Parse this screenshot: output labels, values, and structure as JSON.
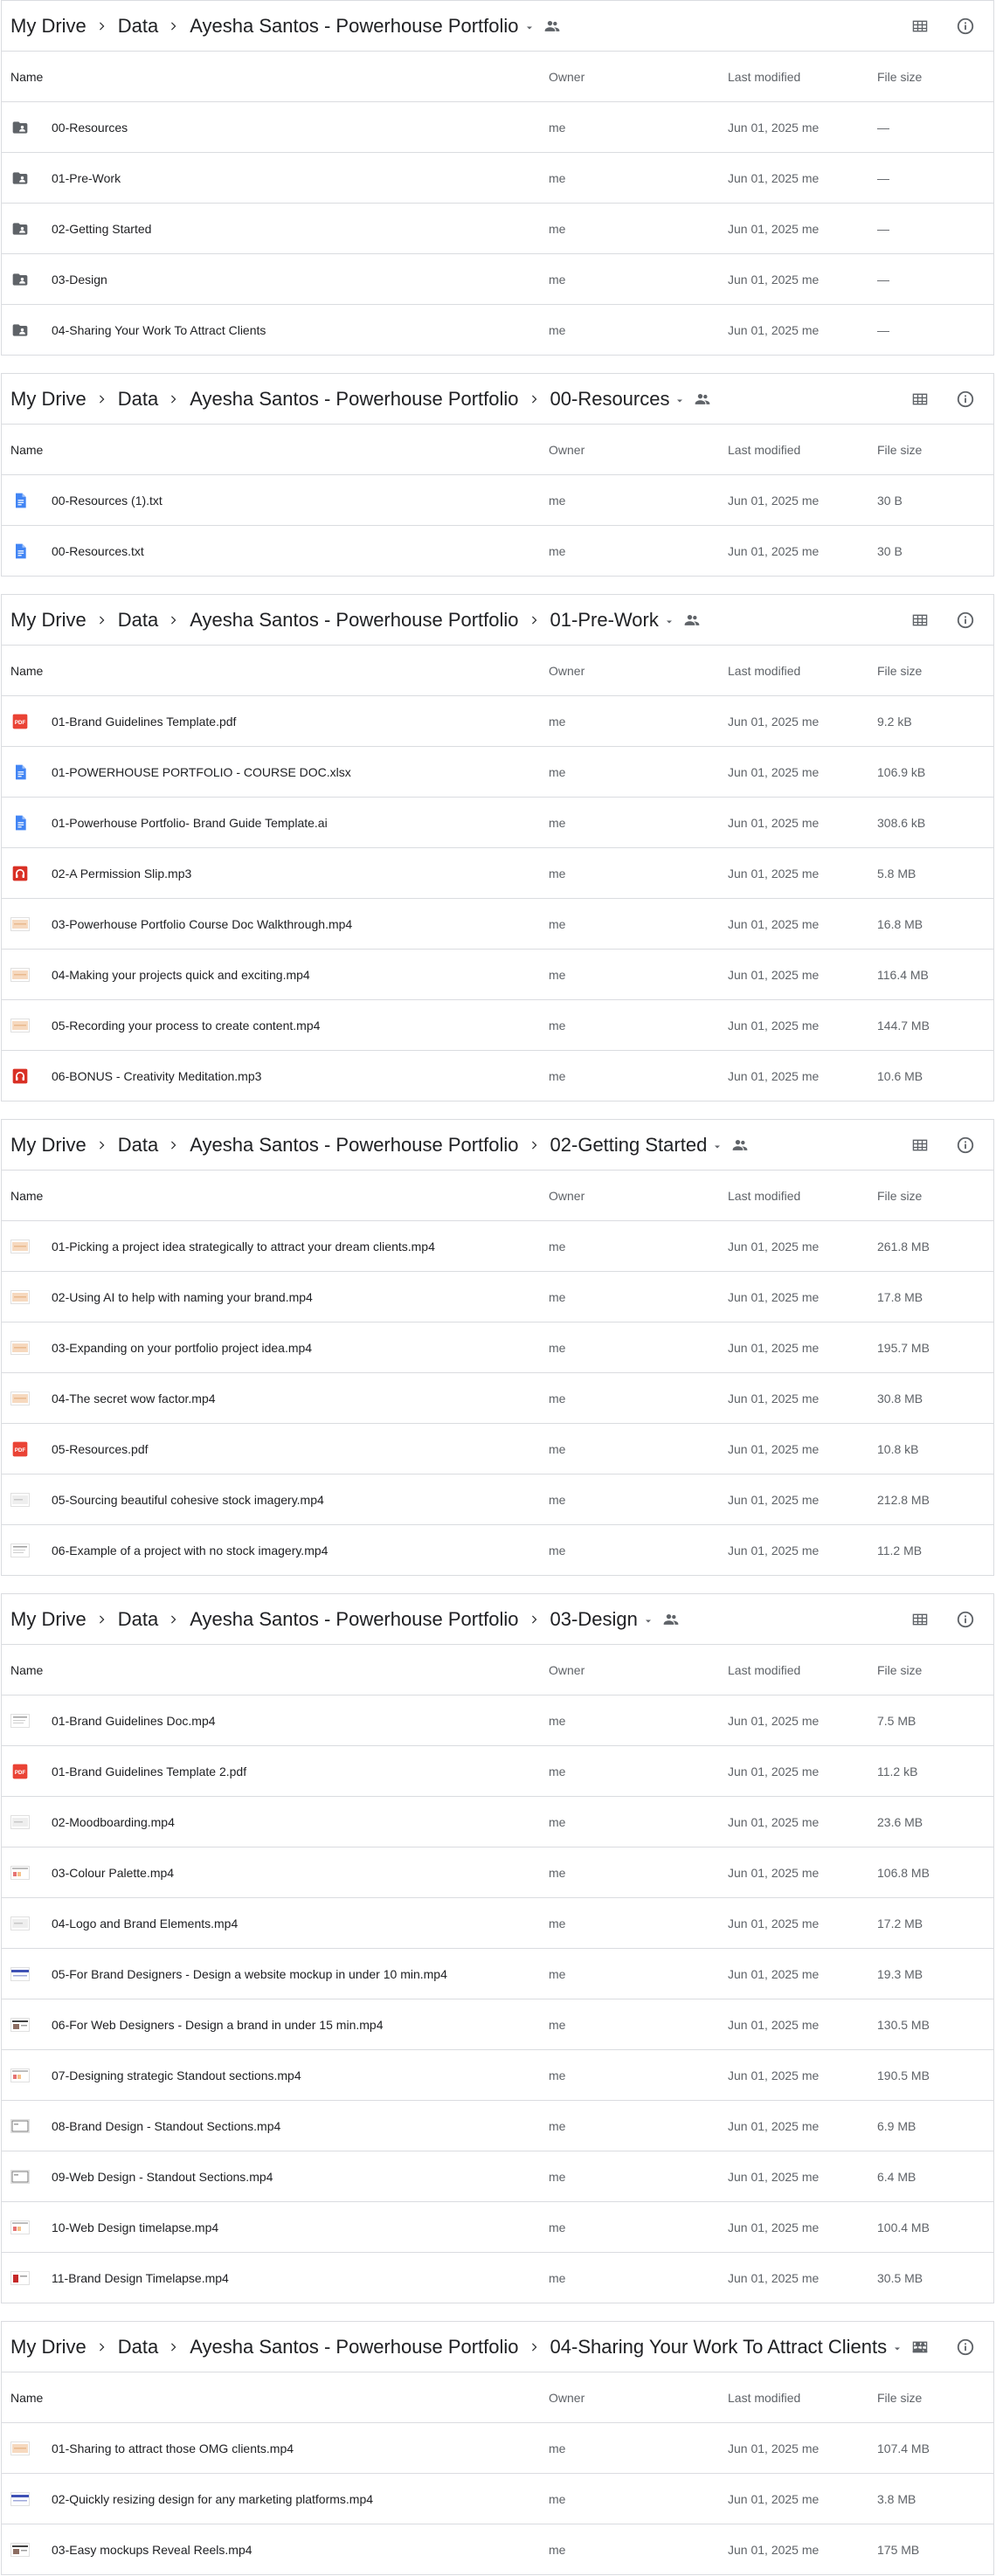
{
  "columns": {
    "name": "Name",
    "owner": "Owner",
    "modified": "Last modified",
    "size": "File size"
  },
  "colors": {
    "folder": "#5f6368",
    "doc": "#4285f4",
    "pdf": "#ea4335",
    "audio": "#d93025",
    "border": "#dadce0"
  },
  "panels": [
    {
      "crumbs": [
        "My Drive",
        "Data",
        "Ayesha Santos - Powerhouse Portfolio"
      ],
      "rows": [
        {
          "icon": "folder-shared",
          "name": "00-Resources",
          "owner": "me",
          "modified": "Jun 01, 2025 me",
          "size": "—"
        },
        {
          "icon": "folder-shared",
          "name": "01-Pre-Work",
          "owner": "me",
          "modified": "Jun 01, 2025 me",
          "size": "—"
        },
        {
          "icon": "folder-shared",
          "name": "02-Getting Started",
          "owner": "me",
          "modified": "Jun 01, 2025 me",
          "size": "—"
        },
        {
          "icon": "folder-shared",
          "name": "03-Design",
          "owner": "me",
          "modified": "Jun 01, 2025 me",
          "size": "—"
        },
        {
          "icon": "folder-shared",
          "name": "04-Sharing Your Work To Attract Clients",
          "owner": "me",
          "modified": "Jun 01, 2025 me",
          "size": "—"
        }
      ]
    },
    {
      "crumbs": [
        "My Drive",
        "Data",
        "Ayesha Santos - Powerhouse Portfolio",
        "00-Resources"
      ],
      "rows": [
        {
          "icon": "doc",
          "name": "00-Resources (1).txt",
          "owner": "me",
          "modified": "Jun 01, 2025 me",
          "size": "30 B"
        },
        {
          "icon": "doc",
          "name": "00-Resources.txt",
          "owner": "me",
          "modified": "Jun 01, 2025 me",
          "size": "30 B"
        }
      ]
    },
    {
      "crumbs": [
        "My Drive",
        "Data",
        "Ayesha Santos - Powerhouse Portfolio",
        "01-Pre-Work"
      ],
      "rows": [
        {
          "icon": "pdf",
          "name": "01-Brand Guidelines Template.pdf",
          "owner": "me",
          "modified": "Jun 01, 2025 me",
          "size": "9.2 kB"
        },
        {
          "icon": "doc",
          "name": "01-POWERHOUSE PORTFOLIO - COURSE DOC.xlsx",
          "owner": "me",
          "modified": "Jun 01, 2025 me",
          "size": "106.9 kB"
        },
        {
          "icon": "doc",
          "name": "01-Powerhouse Portfolio- Brand Guide Template.ai",
          "owner": "me",
          "modified": "Jun 01, 2025 me",
          "size": "308.6 kB"
        },
        {
          "icon": "audio",
          "name": "02-A Permission Slip.mp3",
          "owner": "me",
          "modified": "Jun 01, 2025 me",
          "size": "5.8 MB"
        },
        {
          "icon": "video-beige",
          "name": "03-Powerhouse Portfolio Course Doc Walkthrough.mp4",
          "owner": "me",
          "modified": "Jun 01, 2025 me",
          "size": "16.8 MB"
        },
        {
          "icon": "video-beige",
          "name": "04-Making your projects quick and exciting.mp4",
          "owner": "me",
          "modified": "Jun 01, 2025 me",
          "size": "116.4 MB"
        },
        {
          "icon": "video-beige",
          "name": "05-Recording your process to create content.mp4",
          "owner": "me",
          "modified": "Jun 01, 2025 me",
          "size": "144.7 MB"
        },
        {
          "icon": "audio",
          "name": "06-BONUS - Creativity Meditation.mp3",
          "owner": "me",
          "modified": "Jun 01, 2025 me",
          "size": "10.6 MB"
        }
      ]
    },
    {
      "crumbs": [
        "My Drive",
        "Data",
        "Ayesha Santos - Powerhouse Portfolio",
        "02-Getting Started"
      ],
      "rows": [
        {
          "icon": "video-beige",
          "name": "01-Picking a project idea strategically to attract your dream clients.mp4",
          "owner": "me",
          "modified": "Jun 01, 2025 me",
          "size": "261.8 MB"
        },
        {
          "icon": "video-beige",
          "name": "02-Using AI to help with naming your brand.mp4",
          "owner": "me",
          "modified": "Jun 01, 2025 me",
          "size": "17.8 MB"
        },
        {
          "icon": "video-beige",
          "name": "03-Expanding on your portfolio project idea.mp4",
          "owner": "me",
          "modified": "Jun 01, 2025 me",
          "size": "195.7 MB"
        },
        {
          "icon": "video-beige",
          "name": "04-The secret wow factor.mp4",
          "owner": "me",
          "modified": "Jun 01, 2025 me",
          "size": "30.8 MB"
        },
        {
          "icon": "pdf",
          "name": "05-Resources.pdf",
          "owner": "me",
          "modified": "Jun 01, 2025 me",
          "size": "10.8 kB"
        },
        {
          "icon": "video-grey",
          "name": "05-Sourcing beautiful cohesive stock imagery.mp4",
          "owner": "me",
          "modified": "Jun 01, 2025 me",
          "size": "212.8 MB"
        },
        {
          "icon": "video-lines",
          "name": "06-Example of a project with no stock imagery.mp4",
          "owner": "me",
          "modified": "Jun 01, 2025 me",
          "size": "11.2 MB"
        }
      ]
    },
    {
      "crumbs": [
        "My Drive",
        "Data",
        "Ayesha Santos - Powerhouse Portfolio",
        "03-Design"
      ],
      "rows": [
        {
          "icon": "video-lines",
          "name": "01-Brand Guidelines Doc.mp4",
          "owner": "me",
          "modified": "Jun 01, 2025 me",
          "size": "7.5 MB"
        },
        {
          "icon": "pdf",
          "name": "01-Brand Guidelines Template 2.pdf",
          "owner": "me",
          "modified": "Jun 01, 2025 me",
          "size": "11.2 kB"
        },
        {
          "icon": "video-grey",
          "name": "02-Moodboarding.mp4",
          "owner": "me",
          "modified": "Jun 01, 2025 me",
          "size": "23.6 MB"
        },
        {
          "icon": "video-color",
          "name": "03-Colour Palette.mp4",
          "owner": "me",
          "modified": "Jun 01, 2025 me",
          "size": "106.8 MB"
        },
        {
          "icon": "video-grey",
          "name": "04-Logo and Brand Elements.mp4",
          "owner": "me",
          "modified": "Jun 01, 2025 me",
          "size": "17.2 MB"
        },
        {
          "icon": "video-blue",
          "name": "05-For Brand Designers - Design a website mockup in under 10 min.mp4",
          "owner": "me",
          "modified": "Jun 01, 2025 me",
          "size": "19.3 MB"
        },
        {
          "icon": "video-dark",
          "name": "06-For Web Designers - Design a brand in under 15 min.mp4",
          "owner": "me",
          "modified": "Jun 01, 2025 me",
          "size": "130.5 MB"
        },
        {
          "icon": "video-color",
          "name": "07-Designing strategic Standout sections.mp4",
          "owner": "me",
          "modified": "Jun 01, 2025 me",
          "size": "190.5 MB"
        },
        {
          "icon": "video-frame",
          "name": "08-Brand Design - Standout Sections.mp4",
          "owner": "me",
          "modified": "Jun 01, 2025 me",
          "size": "6.9 MB"
        },
        {
          "icon": "video-frame",
          "name": "09-Web Design - Standout Sections.mp4",
          "owner": "me",
          "modified": "Jun 01, 2025 me",
          "size": "6.4 MB"
        },
        {
          "icon": "video-color",
          "name": "10-Web Design timelapse.mp4",
          "owner": "me",
          "modified": "Jun 01, 2025 me",
          "size": "100.4 MB"
        },
        {
          "icon": "video-red",
          "name": "11-Brand Design Timelapse.mp4",
          "owner": "me",
          "modified": "Jun 01, 2025 me",
          "size": "30.5 MB"
        }
      ]
    },
    {
      "crumbs": [
        "My Drive",
        "Data",
        "Ayesha Santos - Powerhouse Portfolio",
        "04-Sharing Your Work To Attract Clients"
      ],
      "rows": [
        {
          "icon": "video-beige",
          "name": "01-Sharing to attract those OMG clients.mp4",
          "owner": "me",
          "modified": "Jun 01, 2025 me",
          "size": "107.4 MB"
        },
        {
          "icon": "video-blue",
          "name": "02-Quickly resizing design for any marketing platforms.mp4",
          "owner": "me",
          "modified": "Jun 01, 2025 me",
          "size": "3.8 MB"
        },
        {
          "icon": "video-dark",
          "name": "03-Easy mockups Reveal Reels.mp4",
          "owner": "me",
          "modified": "Jun 01, 2025 me",
          "size": "175 MB"
        }
      ]
    }
  ]
}
